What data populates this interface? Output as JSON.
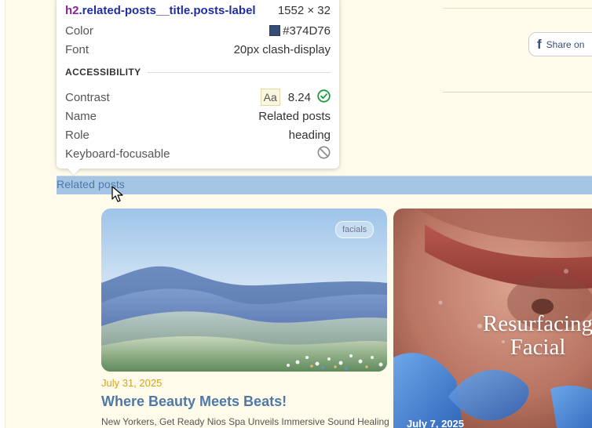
{
  "inspector": {
    "selector_tag": "h2",
    "selector_classes": ".related-posts__title.posts-label",
    "dimensions": "1552 × 32",
    "color_label": "Color",
    "color_value": "#374D76",
    "font_label": "Font",
    "font_value": "20px clash-display",
    "accessibility_heading": "ACCESSIBILITY",
    "contrast_label": "Contrast",
    "contrast_sample": "Aa",
    "contrast_value": "8.24",
    "name_label": "Name",
    "name_value": "Related posts",
    "role_label": "Role",
    "role_value": "heading",
    "keyboard_label": "Keyboard-focusable",
    "swatch_color": "#374d76"
  },
  "share": {
    "label": "Share on",
    "icon": "facebook-icon"
  },
  "related": {
    "title": "Related posts"
  },
  "cards": [
    {
      "tag": "facials",
      "date": "July 31, 2025",
      "title": "Where Beauty Meets Beats!",
      "excerpt": "New Yorkers, Get Ready Nios Spa Unveils Immersive Sound Healing"
    },
    {
      "overlay_line1": "Resurfacing",
      "overlay_line2": "Facial",
      "date": "July 7, 2025"
    }
  ],
  "colors": {
    "page_bg": "#fefbea",
    "accent_blue": "#4f78a8",
    "date_gold": "#d5a21d",
    "highlight": "#a5c5e4"
  }
}
